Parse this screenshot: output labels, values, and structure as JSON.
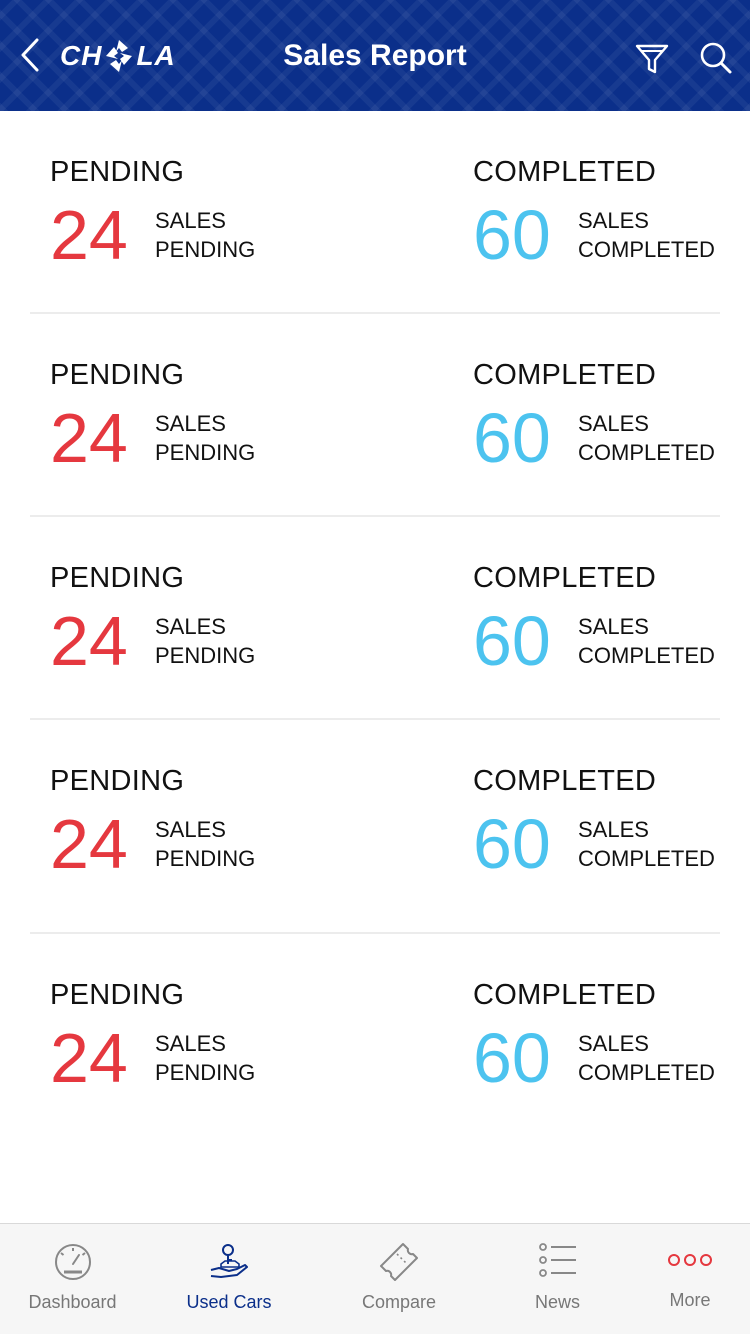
{
  "header": {
    "title": "Sales Report",
    "logo_text_left": "CH",
    "logo_text_right": "LA",
    "back_icon": "chevron-left-icon",
    "filter_icon": "filter-icon",
    "search_icon": "search-icon"
  },
  "colors": {
    "header_bg": "#0b2f8a",
    "pending": "#e5383f",
    "completed": "#4cc3ef",
    "nav_active": "#0b2f8a",
    "more_dots": "#e5383f"
  },
  "reports": [
    {
      "pending": {
        "heading": "PENDING",
        "number": "24",
        "line1": "SALES",
        "line2": "PENDING"
      },
      "completed": {
        "heading": "COMPLETED",
        "number": "60",
        "line1": "SALES",
        "line2": "COMPLETED"
      }
    },
    {
      "pending": {
        "heading": "PENDING",
        "number": "24",
        "line1": "SALES",
        "line2": "PENDING"
      },
      "completed": {
        "heading": "COMPLETED",
        "number": "60",
        "line1": "SALES",
        "line2": "COMPLETED"
      }
    },
    {
      "pending": {
        "heading": "PENDING",
        "number": "24",
        "line1": "SALES",
        "line2": "PENDING"
      },
      "completed": {
        "heading": "COMPLETED",
        "number": "60",
        "line1": "SALES",
        "line2": "COMPLETED"
      }
    },
    {
      "pending": {
        "heading": "PENDING",
        "number": "24",
        "line1": "SALES",
        "line2": "PENDING"
      },
      "completed": {
        "heading": "COMPLETED",
        "number": "60",
        "line1": "SALES",
        "line2": "COMPLETED"
      }
    },
    {
      "pending": {
        "heading": "PENDING",
        "number": "24",
        "line1": "SALES",
        "line2": "PENDING"
      },
      "completed": {
        "heading": "COMPLETED",
        "number": "60",
        "line1": "SALES",
        "line2": "COMPLETED"
      }
    }
  ],
  "nav": {
    "items": [
      {
        "label": "Dashboard",
        "icon": "speedometer-icon",
        "active": false
      },
      {
        "label": "Used Cars",
        "icon": "hand-car-key-icon",
        "active": true
      },
      {
        "label": "Compare",
        "icon": "ticket-icon",
        "active": false
      },
      {
        "label": "News",
        "icon": "list-icon",
        "active": false
      },
      {
        "label": "More",
        "icon": "more-dots-icon",
        "active": false
      }
    ]
  }
}
